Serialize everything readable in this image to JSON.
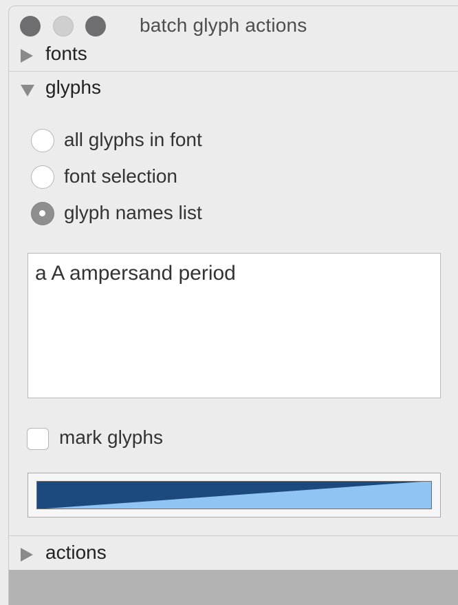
{
  "window": {
    "title": "batch glyph actions"
  },
  "sections": {
    "fonts": {
      "label": "fonts",
      "expanded": false,
      "icon": "disclosure-triangle-right-icon"
    },
    "glyphs": {
      "label": "glyphs",
      "expanded": true,
      "icon": "disclosure-triangle-down-icon"
    },
    "actions": {
      "label": "actions",
      "expanded": false,
      "icon": "disclosure-triangle-right-icon"
    }
  },
  "glyph_source": {
    "options": [
      {
        "label": "all glyphs in font",
        "selected": false
      },
      {
        "label": "font selection",
        "selected": false
      },
      {
        "label": "glyph names list",
        "selected": true
      }
    ]
  },
  "glyph_names": {
    "value": "a A ampersand period"
  },
  "mark_glyphs": {
    "label": "mark glyphs",
    "checked": false
  },
  "mark_color": {
    "color_primary": "#1c4a7e",
    "color_secondary": "#8fc4f3"
  },
  "colors": {
    "window_bg": "#ececec",
    "traffic_light_inactive": "#6e6e70",
    "bottom_bar": "#b3b3b3"
  }
}
